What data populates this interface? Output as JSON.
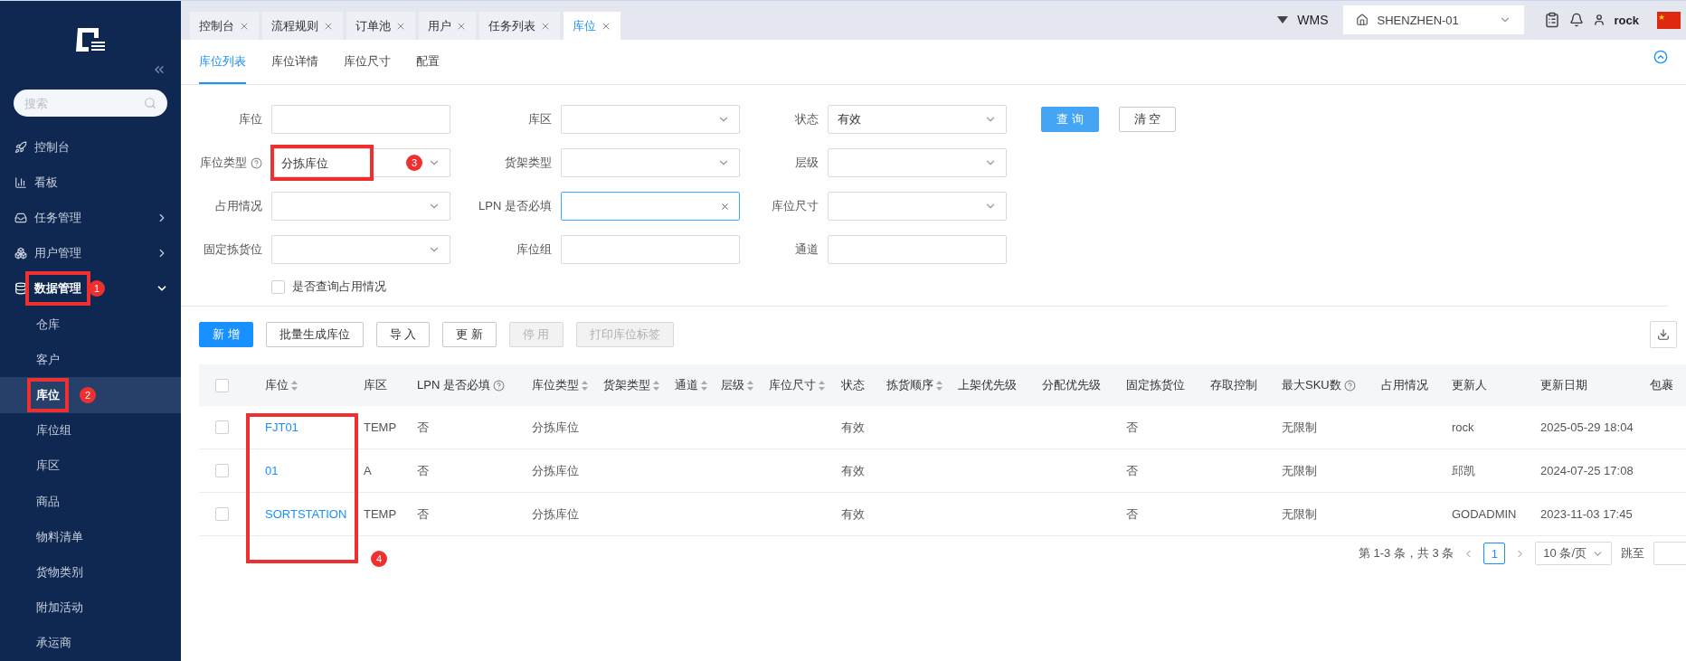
{
  "sidebar": {
    "search": {
      "placeholder": "搜索"
    },
    "items": [
      {
        "label": "控制台",
        "selected": false
      },
      {
        "label": "看板",
        "selected": false
      },
      {
        "label": "任务管理",
        "selected": false,
        "expanded": false
      },
      {
        "label": "用户管理",
        "selected": false,
        "expanded": false
      },
      {
        "label": "数据管理",
        "selected": false,
        "expanded": true,
        "annotation": "1",
        "children": [
          {
            "label": "仓库",
            "selected": false
          },
          {
            "label": "客户",
            "selected": false
          },
          {
            "label": "库位",
            "selected": true,
            "annotation": "2"
          },
          {
            "label": "库位组",
            "selected": false
          },
          {
            "label": "库区",
            "selected": false
          },
          {
            "label": "商品",
            "selected": false
          },
          {
            "label": "物料清单",
            "selected": false
          },
          {
            "label": "货物类别",
            "selected": false
          },
          {
            "label": "附加活动",
            "selected": false
          },
          {
            "label": "承运商",
            "selected": false
          }
        ]
      }
    ]
  },
  "tabs": [
    {
      "label": "控制台",
      "selected": false
    },
    {
      "label": "流程规则",
      "selected": false
    },
    {
      "label": "订单池",
      "selected": false
    },
    {
      "label": "用户",
      "selected": false
    },
    {
      "label": "任务列表",
      "selected": false
    },
    {
      "label": "库位",
      "selected": true
    }
  ],
  "header": {
    "system": "WMS",
    "warehouse": "SHENZHEN-01",
    "user": "rock"
  },
  "subtabs": [
    {
      "label": "库位列表",
      "selected": true
    },
    {
      "label": "库位详情",
      "selected": false
    },
    {
      "label": "库位尺寸",
      "selected": false
    },
    {
      "label": "配置",
      "selected": false
    }
  ],
  "filters": [
    {
      "label": "库位",
      "kind": "input"
    },
    {
      "label": "库区",
      "kind": "select"
    },
    {
      "label": "状态",
      "kind": "select",
      "value": "有效"
    },
    {
      "label": "库位类型",
      "kind": "select",
      "help": true,
      "value": "分拣库位",
      "annotation": "3"
    },
    {
      "label": "货架类型",
      "kind": "select"
    },
    {
      "label": "层级",
      "kind": "select"
    },
    {
      "label": "占用情况",
      "kind": "select"
    },
    {
      "label": "LPN 是否必填",
      "kind": "select",
      "focused": true
    },
    {
      "label": "库位尺寸",
      "kind": "select"
    },
    {
      "label": "固定拣货位",
      "kind": "select"
    },
    {
      "label": "库位组",
      "kind": "input"
    },
    {
      "label": "通道",
      "kind": "input"
    }
  ],
  "search_buttons": [
    {
      "label": "查 询",
      "kind": "primary"
    },
    {
      "label": "清 空",
      "kind": "default"
    }
  ],
  "occupancy_checkbox": {
    "label": "是否查询占用情况",
    "checked": false
  },
  "actions": [
    {
      "label": "新 增",
      "kind": "primary",
      "disabled": false
    },
    {
      "label": "批量生成库位",
      "kind": "default",
      "disabled": false
    },
    {
      "label": "导 入",
      "kind": "default",
      "disabled": false
    },
    {
      "label": "更 新",
      "kind": "default",
      "disabled": false
    },
    {
      "label": "停 用",
      "kind": "default",
      "disabled": true
    },
    {
      "label": "打印库位标签",
      "kind": "default",
      "disabled": true
    }
  ],
  "table": {
    "all_checked": false,
    "columns": [
      {
        "label": "库位",
        "sortable": true,
        "annotation": "4"
      },
      {
        "label": "库区"
      },
      {
        "label": "LPN 是否必填",
        "help": true
      },
      {
        "label": "库位类型",
        "sortable": true
      },
      {
        "label": "货架类型",
        "sortable": true
      },
      {
        "label": "通道",
        "sortable": true
      },
      {
        "label": "层级",
        "sortable": true
      },
      {
        "label": "库位尺寸",
        "sortable": true
      },
      {
        "label": "状态"
      },
      {
        "label": "拣货顺序",
        "sortable": true
      },
      {
        "label": "上架优先级"
      },
      {
        "label": "分配优先级"
      },
      {
        "label": "固定拣货位"
      },
      {
        "label": "存取控制"
      },
      {
        "label": "最大SKU数",
        "help": true
      },
      {
        "label": "占用情况"
      },
      {
        "label": "更新人"
      },
      {
        "label": "更新日期"
      },
      {
        "label": "包裹"
      }
    ],
    "rows": [
      {
        "checked": false,
        "cells": [
          "FJT01",
          "TEMP",
          "否",
          "分拣库位",
          null,
          null,
          null,
          null,
          "有效",
          null,
          null,
          null,
          "否",
          null,
          "无限制",
          null,
          "rock",
          "2025-05-29 18:04",
          null
        ]
      },
      {
        "checked": false,
        "cells": [
          "01",
          "A",
          "否",
          "分拣库位",
          null,
          null,
          null,
          null,
          "有效",
          null,
          null,
          null,
          "否",
          null,
          "无限制",
          null,
          "邱凯",
          "2024-07-25 17:08",
          null
        ]
      },
      {
        "checked": false,
        "cells": [
          "SORTSTATION",
          "TEMP",
          "否",
          "分拣库位",
          null,
          null,
          null,
          null,
          "有效",
          null,
          null,
          null,
          "否",
          null,
          "无限制",
          null,
          "GODADMIN",
          "2023-11-03 17:45",
          null
        ]
      }
    ]
  },
  "pagination": {
    "summary": "第 1-3 条，共 3 条",
    "pages": [
      {
        "label": "1",
        "selected": true
      }
    ],
    "page_size": "10 条/页",
    "jump_label": "跳至"
  }
}
